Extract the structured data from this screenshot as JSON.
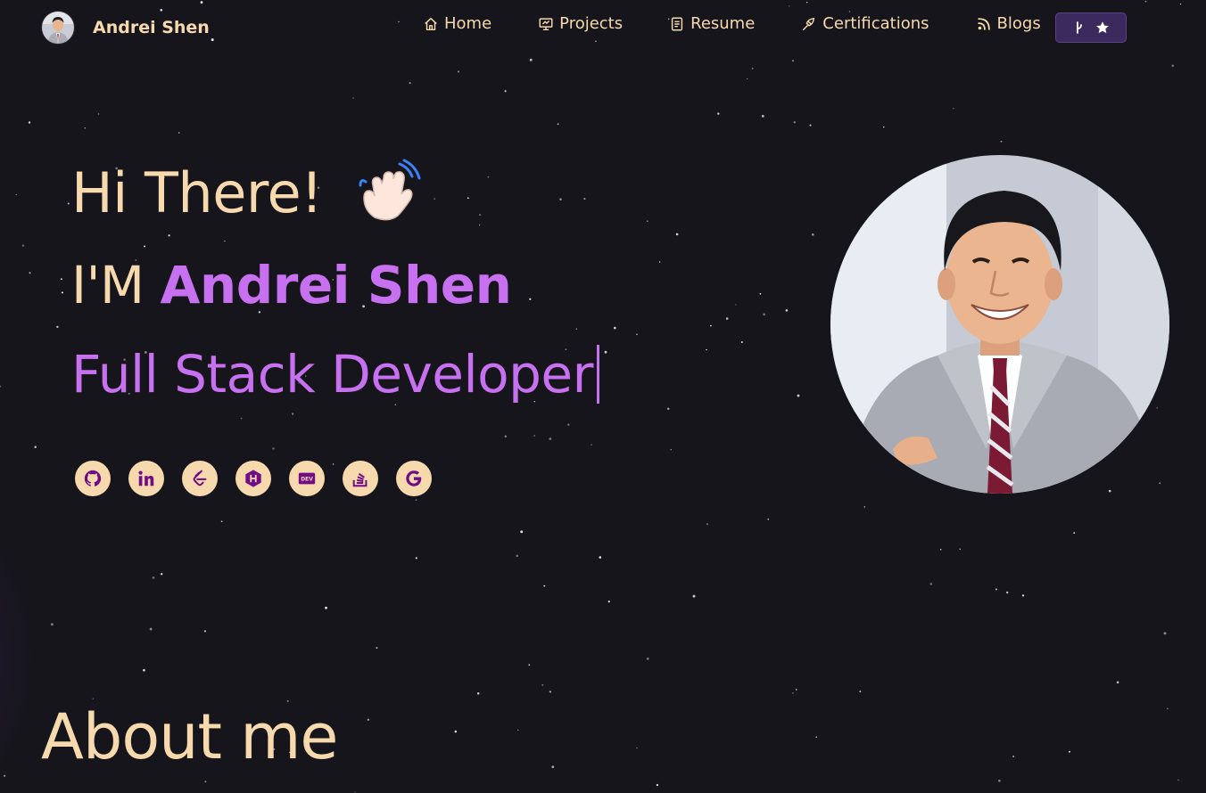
{
  "brand": {
    "name": "Andrei Shen"
  },
  "nav": {
    "items": [
      {
        "label": "Home",
        "icon": "home-icon"
      },
      {
        "label": "Projects",
        "icon": "projects-icon"
      },
      {
        "label": "Resume",
        "icon": "resume-icon"
      },
      {
        "label": "Certifications",
        "icon": "certifications-icon"
      },
      {
        "label": "Blogs",
        "icon": "blogs-icon"
      }
    ],
    "fork_button": {
      "icons": [
        "git-fork-icon",
        "star-icon"
      ]
    }
  },
  "hero": {
    "greeting": "Hi There!",
    "greeting_emoji": "waving-hand-icon",
    "intro_prefix": "I'M",
    "name": "Andrei Shen",
    "role": "Full Stack Developer"
  },
  "socials": [
    {
      "icon": "github-icon"
    },
    {
      "icon": "linkedin-icon"
    },
    {
      "icon": "leetcode-icon"
    },
    {
      "icon": "hashnode-icon"
    },
    {
      "icon": "devto-icon"
    },
    {
      "icon": "stackoverflow-icon"
    },
    {
      "icon": "google-icon"
    }
  ],
  "about": {
    "heading": "About me"
  },
  "colors": {
    "background": "#16151c",
    "accent": "#c770f0",
    "text": "#f7d9ae",
    "button": "#3c2a5e"
  }
}
